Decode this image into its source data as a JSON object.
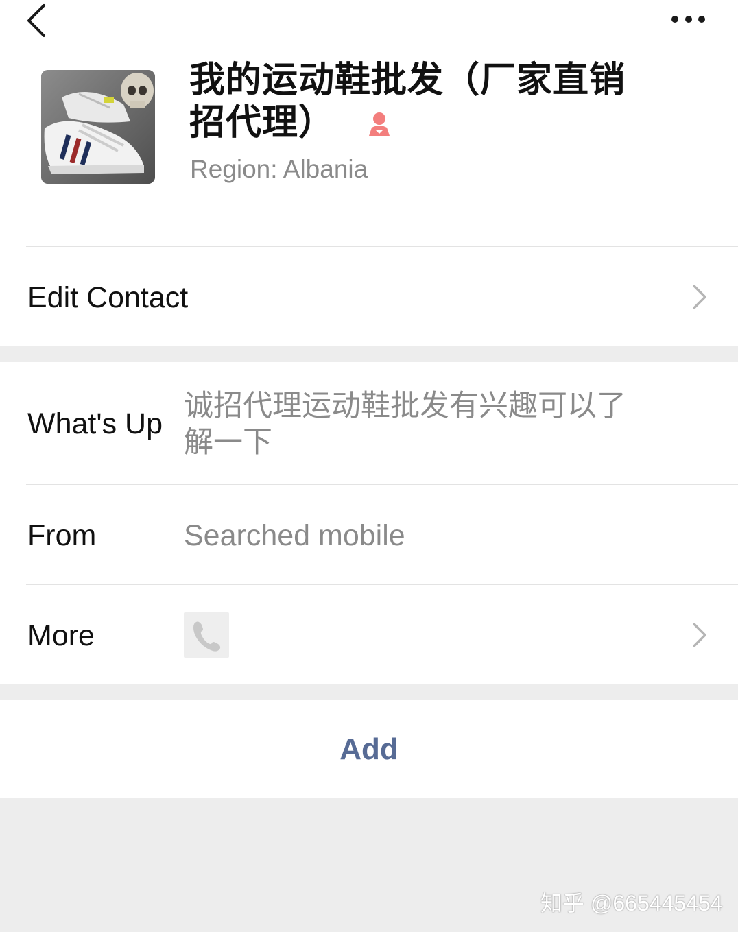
{
  "nav": {
    "back_icon": "chevron-left-icon",
    "more_icon": "ellipsis-icon"
  },
  "profile": {
    "name_line1": "我的运动鞋批发（厂家直销",
    "name_line2": "招代理）",
    "gender_icon": "female-icon",
    "gender_color": "#f37e7d",
    "region": "Region: Albania"
  },
  "edit_contact": {
    "label": "Edit Contact"
  },
  "details": {
    "whats_up_label": "What's Up",
    "whats_up_line1": "诚招代理运动鞋批发有兴趣可以了",
    "whats_up_line2": "解一下",
    "from_label": "From",
    "from_value": "Searched mobile",
    "more_label": "More",
    "more_icon": "phone-icon"
  },
  "action": {
    "add_label": "Add",
    "add_color": "#576b95"
  },
  "watermark": {
    "text": "知乎 @665445454"
  }
}
